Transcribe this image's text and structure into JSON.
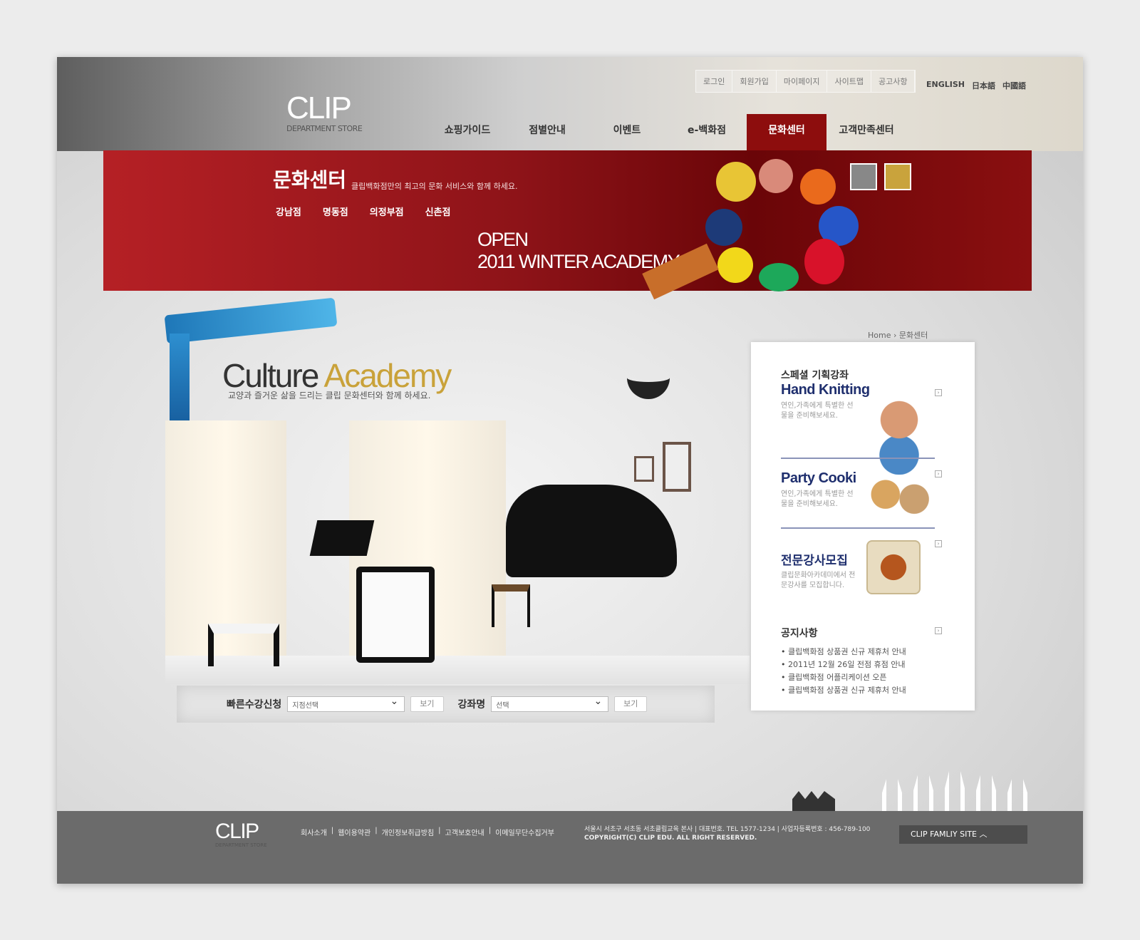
{
  "util_links": [
    "로그인",
    "회원가입",
    "마이페이지",
    "사이트맵",
    "공고사항"
  ],
  "languages": [
    "ENGLISH",
    "日本語",
    "中國語"
  ],
  "logo": {
    "name": "CLIP",
    "tagline": "DEPARTMENT STORE"
  },
  "nav": [
    {
      "label": "쇼핑가이드"
    },
    {
      "label": "점별안내"
    },
    {
      "label": "이벤트"
    },
    {
      "label": "e-백화점"
    },
    {
      "label": "문화센터",
      "active": true
    },
    {
      "label": "고객만족센터"
    }
  ],
  "banner": {
    "title": "문화센터",
    "subtitle": "클립백화점만의 최고의 문화 서비스와 함께 하세요.",
    "branches": [
      "강남점",
      "명동점",
      "의정부점",
      "신촌점"
    ],
    "open_line1": "OPEN",
    "open_line2": "2011 WINTER ACADEMY"
  },
  "hero": {
    "title_a": "Culture",
    "title_b": "Academy",
    "subtitle": "교양과 즐거운 삶을 드리는 클립 문화센터와 함께 하세요."
  },
  "quick": {
    "label": "빠른수강신청",
    "branch_select": "지점선택",
    "view1": "보기",
    "course_label": "강좌명",
    "course_select": "선택",
    "view2": "보기"
  },
  "breadcrumb": {
    "home": "Home",
    "sep": "›",
    "current": "문화센터"
  },
  "side": {
    "special": {
      "kicker": "스페셜 기획강좌",
      "title": "Hand Knitting",
      "desc": "연인,가족에게 특별한 선물을 준비해보세요."
    },
    "party": {
      "title": "Party Cooki",
      "desc": "연인,가족에게 특별한 선물을 준비해보세요."
    },
    "recruit": {
      "title": "전문강사모집",
      "desc": "클립문화아카데미에서 전문강사를 모집합니다."
    },
    "notice": {
      "title": "공지사항",
      "items": [
        "클립백화점 상품권 신규 제휴처 안내",
        "2011년 12월 26일 전점 휴점 안내",
        "클립백화점 어플리케이션 오픈",
        "클립백화점 상품권 신규 제휴처 안내"
      ]
    }
  },
  "footer": {
    "links": [
      "회사소개",
      "|",
      "웹이용약관",
      "|",
      "개인정보취급방침",
      "|",
      "고객보호안내",
      "|",
      "이메일무단수집거부"
    ],
    "address": "서울시 서초구 서초동 서초클립교육 본사   | 대표번호. TEL 1577-1234 | 사업자등록번호 : 456-789-100",
    "copyright": "COPYRIGHT(C) CLIP EDU. ALL RIGHT RESERVED.",
    "family_site": "CLIP FAMLIY SITE  ︿"
  },
  "colors": {
    "banner_red": "#8d1318",
    "nav_active": "#8d0d0d",
    "title_blue": "#1f2f6e",
    "footer": "#6b6b6b"
  }
}
